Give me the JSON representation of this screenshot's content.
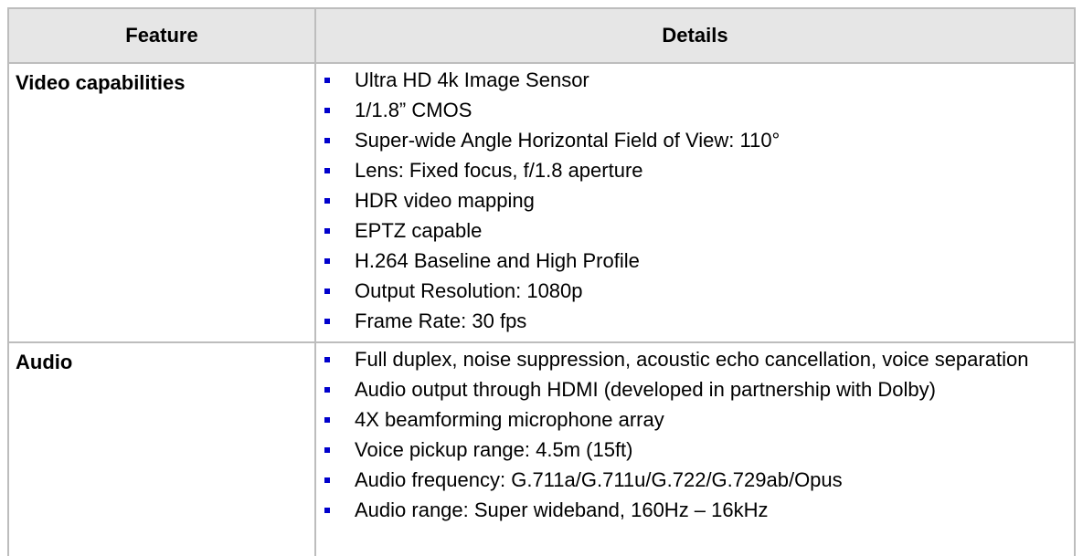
{
  "table": {
    "header": {
      "feature": "Feature",
      "details": "Details"
    },
    "rows": [
      {
        "feature": "Video capabilities",
        "details": [
          "Ultra HD 4k Image Sensor",
          "1/1.8” CMOS",
          "Super-wide Angle Horizontal Field of View: 110°",
          "Lens: Fixed focus, f/1.8 aperture",
          "HDR video mapping",
          "EPTZ capable",
          "H.264 Baseline and High Profile",
          "Output Resolution: 1080p",
          "Frame Rate: 30 fps"
        ]
      },
      {
        "feature": "Audio",
        "details": [
          "Full duplex, noise suppression, acoustic echo cancellation, voice separation",
          "Audio output through HDMI (developed in partnership with Dolby)",
          "4X beamforming microphone array",
          "Voice pickup range: 4.5m (15ft)",
          "Audio frequency: G.711a/G.711u/G.722/G.729ab/Opus",
          "Audio range: Super wideband, 160Hz – 16kHz"
        ]
      }
    ]
  },
  "colors": {
    "bullet": "#0000cc",
    "header_bg": "#e6e6e6",
    "border": "#bdbdbd"
  },
  "icons": {
    "bullet": "square-bullet-icon"
  }
}
